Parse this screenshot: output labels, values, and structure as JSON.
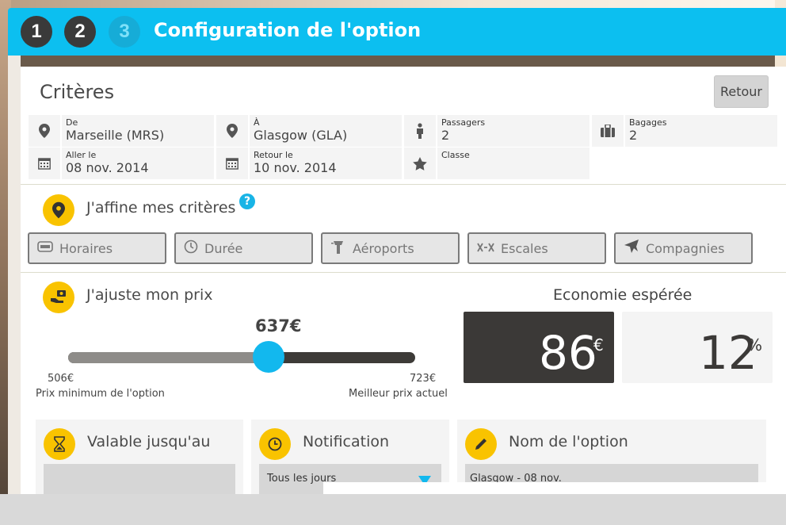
{
  "header": {
    "steps": [
      "1",
      "2",
      "3"
    ],
    "title": "Configuration de l'option"
  },
  "criteria": {
    "title": "Critères",
    "back_button": "Retour",
    "from": {
      "label": "De",
      "value": "Marseille (MRS)"
    },
    "to": {
      "label": "À",
      "value": "Glasgow (GLA)"
    },
    "passengers": {
      "label": "Passagers",
      "value": "2"
    },
    "baggage": {
      "label": "Bagages",
      "value": "2"
    },
    "depart": {
      "label": "Aller le",
      "value": "08 nov. 2014"
    },
    "return": {
      "label": "Retour le",
      "value": "10 nov. 2014"
    },
    "class": {
      "label": "Classe",
      "value": ""
    }
  },
  "refine": {
    "title": "J'affine mes critères",
    "help": "?",
    "filters": [
      {
        "label": "Horaires",
        "icon": "clock-schedule-icon"
      },
      {
        "label": "Durée",
        "icon": "timer-icon"
      },
      {
        "label": "Aéroports",
        "icon": "control-tower-icon"
      },
      {
        "label": "Escales",
        "icon": "stopover-icon"
      },
      {
        "label": "Compagnies",
        "icon": "airplane-icon"
      }
    ]
  },
  "price": {
    "title": "J'ajuste mon prix",
    "current": "637€",
    "current_value": 637,
    "min": "506€",
    "min_value": 506,
    "max": "723€",
    "max_value": 723,
    "min_label": "Prix minimum de l'option",
    "max_label": "Meilleur prix actuel"
  },
  "savings": {
    "title": "Economie espérée",
    "amount": "86",
    "currency": "€",
    "percent": "12",
    "percent_sign": "%"
  },
  "valid_until": {
    "title": "Valable jusqu'au",
    "value": ""
  },
  "notification": {
    "title": "Notification",
    "selected": "Tous les jours"
  },
  "option_name": {
    "title": "Nom de l'option",
    "value": "Glasgow - 08 nov."
  },
  "colors": {
    "accent": "#0cbff0",
    "yellow": "#f9c300",
    "dark": "#3b3937"
  }
}
